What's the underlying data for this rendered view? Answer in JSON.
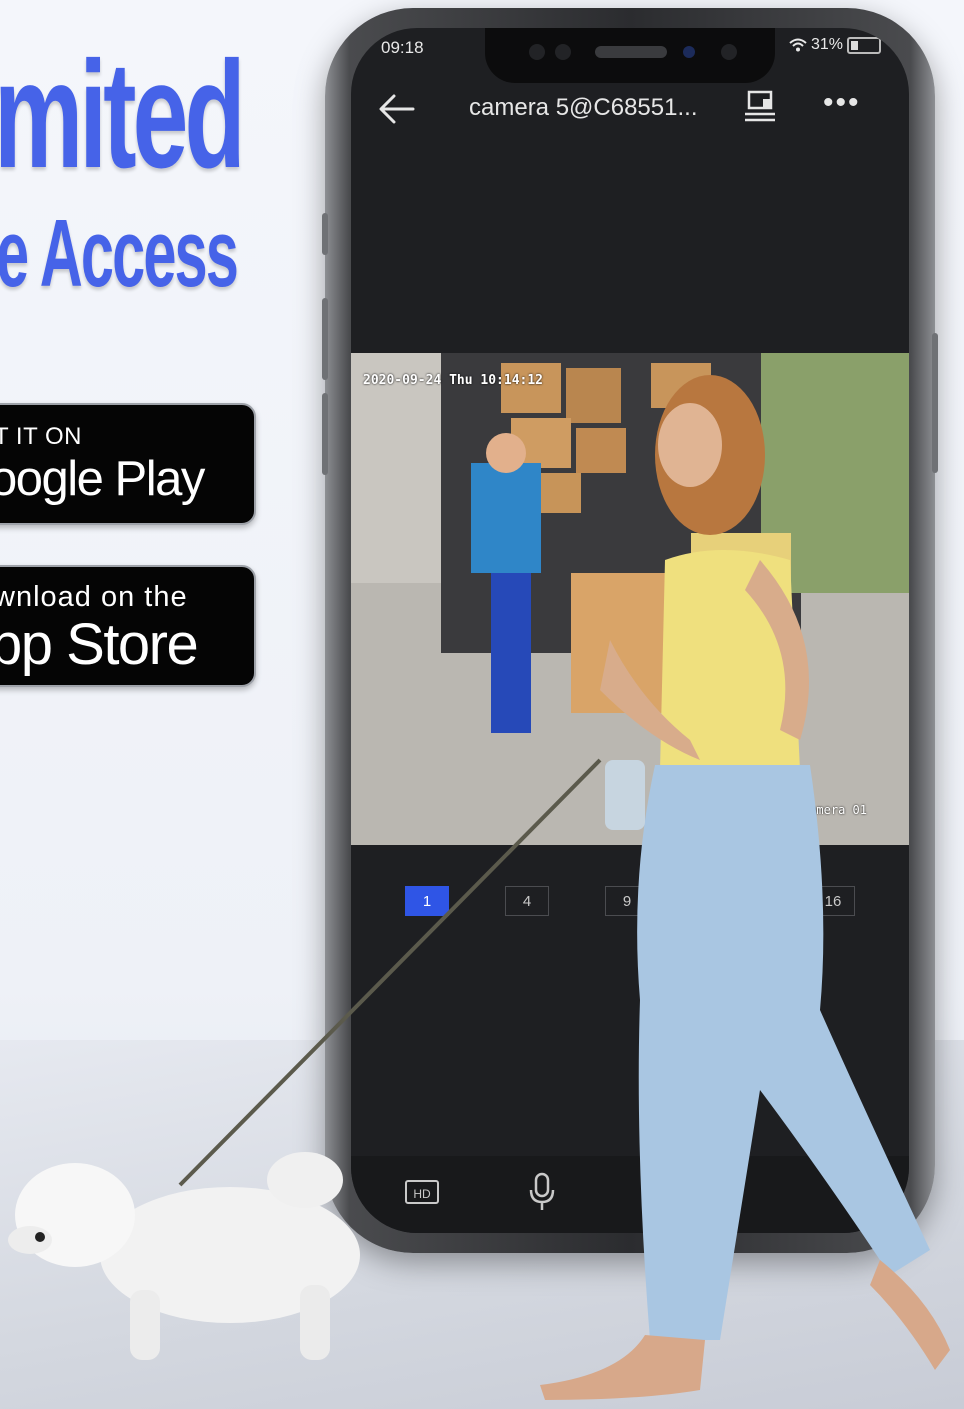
{
  "promo": {
    "headline": "mited",
    "subheadline": "e Access",
    "google_play": {
      "small": "T IT ON",
      "big": "oogle Play"
    },
    "app_store": {
      "small": "wnload on the",
      "big": "pp Store"
    }
  },
  "status_bar": {
    "time": "09:18",
    "battery": "31%"
  },
  "app_header": {
    "title": "camera 5@C68551..."
  },
  "video": {
    "timestamp": "2020-09-24 Thu 10:14:12",
    "camera_name": "Camera 01"
  },
  "split_options": [
    "1",
    "4",
    "9",
    "16"
  ],
  "bottom_toolbar": {
    "hd_label": "HD"
  },
  "colors": {
    "accent": "#2f55e6",
    "headline": "#4663e8",
    "screen_bg": "#1e1f22"
  }
}
